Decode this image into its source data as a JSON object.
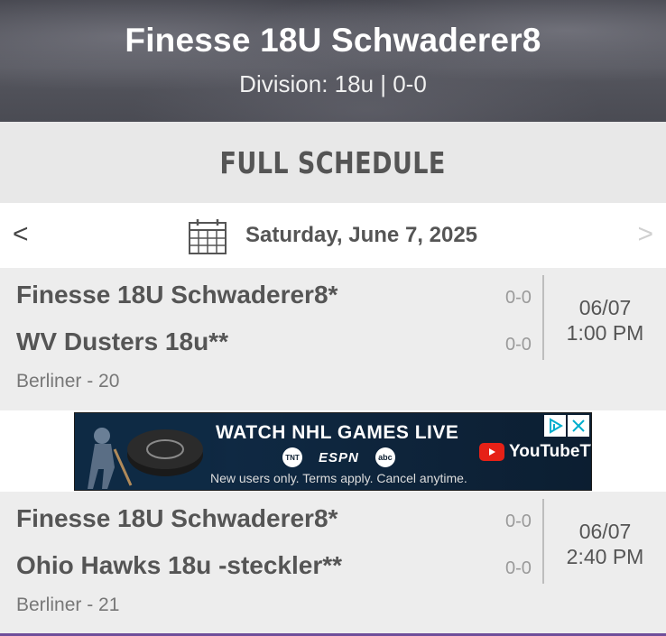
{
  "team": {
    "name": "Finesse 18U Schwaderer8",
    "division_line": "Division: 18u | 0-0"
  },
  "section": {
    "title": "FULL SCHEDULE"
  },
  "datebar": {
    "prev_label": "<",
    "next_label": ">",
    "date": "Saturday, June 7, 2025",
    "calendar_icon": "calendar-icon"
  },
  "games": [
    {
      "home": "Finesse 18U Schwaderer8*",
      "home_record": "0-0",
      "away": "WV Dusters 18u**",
      "away_record": "0-0",
      "date": "06/07",
      "time": "1:00 PM",
      "venue": "Berliner - 20"
    },
    {
      "home": "Finesse 18U Schwaderer8*",
      "home_record": "0-0",
      "away": "Ohio Hawks 18u -steckler**",
      "away_record": "0-0",
      "date": "06/07",
      "time": "2:40 PM",
      "venue": "Berliner - 21"
    }
  ],
  "ad": {
    "headline": "WATCH NHL GAMES LIVE",
    "logo_tnt": "TNT",
    "logo_espn": "ESPN",
    "logo_abc": "abc",
    "fine_print": "New users only. Terms apply. Cancel anytime.",
    "brand": "YouTubeTV"
  },
  "colors": {
    "accent_bottom": "#6e4e9a",
    "youtube_red": "#e62117",
    "row_bg": "#ededed"
  }
}
